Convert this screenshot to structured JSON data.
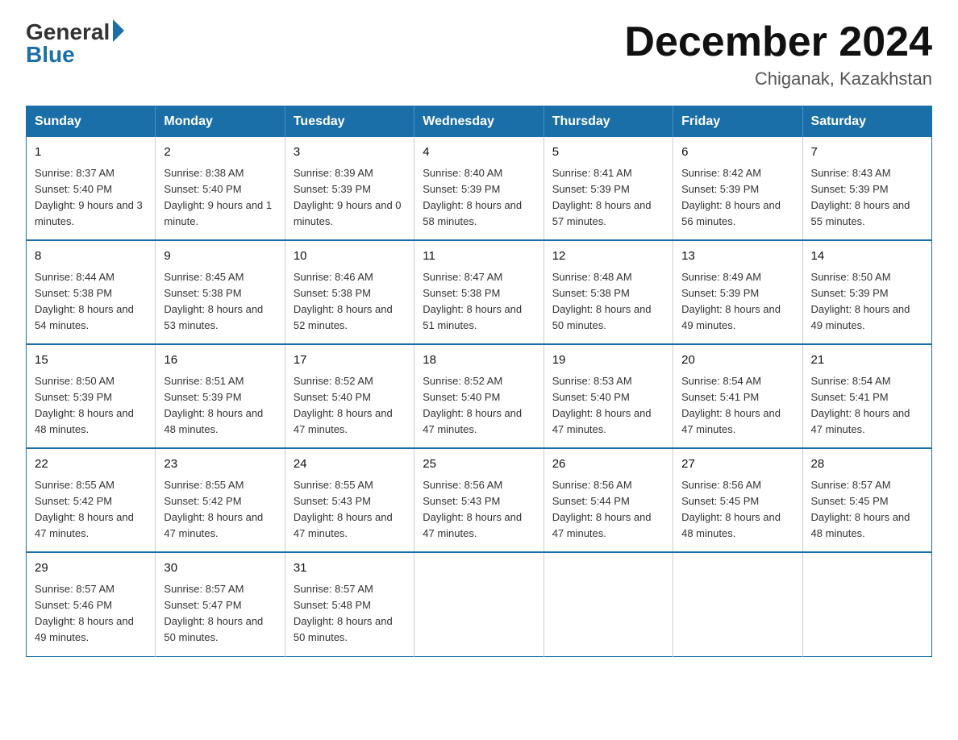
{
  "logo": {
    "general": "General",
    "blue": "Blue"
  },
  "title": "December 2024",
  "location": "Chiganak, Kazakhstan",
  "days_of_week": [
    "Sunday",
    "Monday",
    "Tuesday",
    "Wednesday",
    "Thursday",
    "Friday",
    "Saturday"
  ],
  "weeks": [
    [
      {
        "day": "1",
        "sunrise": "8:37 AM",
        "sunset": "5:40 PM",
        "daylight": "9 hours and 3 minutes."
      },
      {
        "day": "2",
        "sunrise": "8:38 AM",
        "sunset": "5:40 PM",
        "daylight": "9 hours and 1 minute."
      },
      {
        "day": "3",
        "sunrise": "8:39 AM",
        "sunset": "5:39 PM",
        "daylight": "9 hours and 0 minutes."
      },
      {
        "day": "4",
        "sunrise": "8:40 AM",
        "sunset": "5:39 PM",
        "daylight": "8 hours and 58 minutes."
      },
      {
        "day": "5",
        "sunrise": "8:41 AM",
        "sunset": "5:39 PM",
        "daylight": "8 hours and 57 minutes."
      },
      {
        "day": "6",
        "sunrise": "8:42 AM",
        "sunset": "5:39 PM",
        "daylight": "8 hours and 56 minutes."
      },
      {
        "day": "7",
        "sunrise": "8:43 AM",
        "sunset": "5:39 PM",
        "daylight": "8 hours and 55 minutes."
      }
    ],
    [
      {
        "day": "8",
        "sunrise": "8:44 AM",
        "sunset": "5:38 PM",
        "daylight": "8 hours and 54 minutes."
      },
      {
        "day": "9",
        "sunrise": "8:45 AM",
        "sunset": "5:38 PM",
        "daylight": "8 hours and 53 minutes."
      },
      {
        "day": "10",
        "sunrise": "8:46 AM",
        "sunset": "5:38 PM",
        "daylight": "8 hours and 52 minutes."
      },
      {
        "day": "11",
        "sunrise": "8:47 AM",
        "sunset": "5:38 PM",
        "daylight": "8 hours and 51 minutes."
      },
      {
        "day": "12",
        "sunrise": "8:48 AM",
        "sunset": "5:38 PM",
        "daylight": "8 hours and 50 minutes."
      },
      {
        "day": "13",
        "sunrise": "8:49 AM",
        "sunset": "5:39 PM",
        "daylight": "8 hours and 49 minutes."
      },
      {
        "day": "14",
        "sunrise": "8:50 AM",
        "sunset": "5:39 PM",
        "daylight": "8 hours and 49 minutes."
      }
    ],
    [
      {
        "day": "15",
        "sunrise": "8:50 AM",
        "sunset": "5:39 PM",
        "daylight": "8 hours and 48 minutes."
      },
      {
        "day": "16",
        "sunrise": "8:51 AM",
        "sunset": "5:39 PM",
        "daylight": "8 hours and 48 minutes."
      },
      {
        "day": "17",
        "sunrise": "8:52 AM",
        "sunset": "5:40 PM",
        "daylight": "8 hours and 47 minutes."
      },
      {
        "day": "18",
        "sunrise": "8:52 AM",
        "sunset": "5:40 PM",
        "daylight": "8 hours and 47 minutes."
      },
      {
        "day": "19",
        "sunrise": "8:53 AM",
        "sunset": "5:40 PM",
        "daylight": "8 hours and 47 minutes."
      },
      {
        "day": "20",
        "sunrise": "8:54 AM",
        "sunset": "5:41 PM",
        "daylight": "8 hours and 47 minutes."
      },
      {
        "day": "21",
        "sunrise": "8:54 AM",
        "sunset": "5:41 PM",
        "daylight": "8 hours and 47 minutes."
      }
    ],
    [
      {
        "day": "22",
        "sunrise": "8:55 AM",
        "sunset": "5:42 PM",
        "daylight": "8 hours and 47 minutes."
      },
      {
        "day": "23",
        "sunrise": "8:55 AM",
        "sunset": "5:42 PM",
        "daylight": "8 hours and 47 minutes."
      },
      {
        "day": "24",
        "sunrise": "8:55 AM",
        "sunset": "5:43 PM",
        "daylight": "8 hours and 47 minutes."
      },
      {
        "day": "25",
        "sunrise": "8:56 AM",
        "sunset": "5:43 PM",
        "daylight": "8 hours and 47 minutes."
      },
      {
        "day": "26",
        "sunrise": "8:56 AM",
        "sunset": "5:44 PM",
        "daylight": "8 hours and 47 minutes."
      },
      {
        "day": "27",
        "sunrise": "8:56 AM",
        "sunset": "5:45 PM",
        "daylight": "8 hours and 48 minutes."
      },
      {
        "day": "28",
        "sunrise": "8:57 AM",
        "sunset": "5:45 PM",
        "daylight": "8 hours and 48 minutes."
      }
    ],
    [
      {
        "day": "29",
        "sunrise": "8:57 AM",
        "sunset": "5:46 PM",
        "daylight": "8 hours and 49 minutes."
      },
      {
        "day": "30",
        "sunrise": "8:57 AM",
        "sunset": "5:47 PM",
        "daylight": "8 hours and 50 minutes."
      },
      {
        "day": "31",
        "sunrise": "8:57 AM",
        "sunset": "5:48 PM",
        "daylight": "8 hours and 50 minutes."
      },
      null,
      null,
      null,
      null
    ]
  ]
}
